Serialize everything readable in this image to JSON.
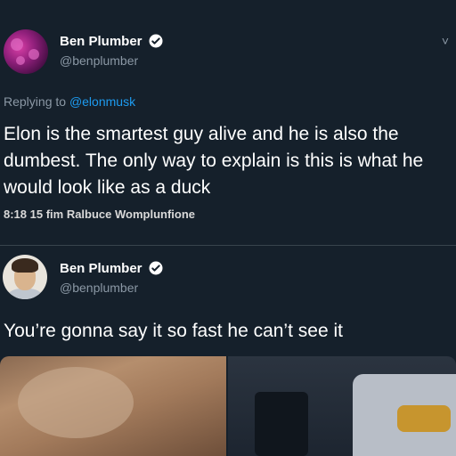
{
  "tweets": [
    {
      "author_name": "Ben Plumber",
      "author_handle": "@benplumber",
      "replying_prefix": "Replying to ",
      "replying_mention": "@elonmusk",
      "text": "Elon is the smartest guy alive and he is also the dumbest. The only way to explain is this is what he would look like as a duck",
      "meta": "8:18 15 fim Ralbuce Womplunfione"
    },
    {
      "author_name": "Ben Plumber",
      "author_handle": "@benplumber",
      "text": "You’re gonna say it so fast he can’t see it"
    }
  ],
  "icons": {
    "verified": "verified-badge-icon",
    "more": "chevron-down-icon"
  },
  "colors": {
    "background": "#15202b",
    "primary_text": "#ffffff",
    "secondary_text": "#8b98a5",
    "accent": "#1d9bf0"
  }
}
